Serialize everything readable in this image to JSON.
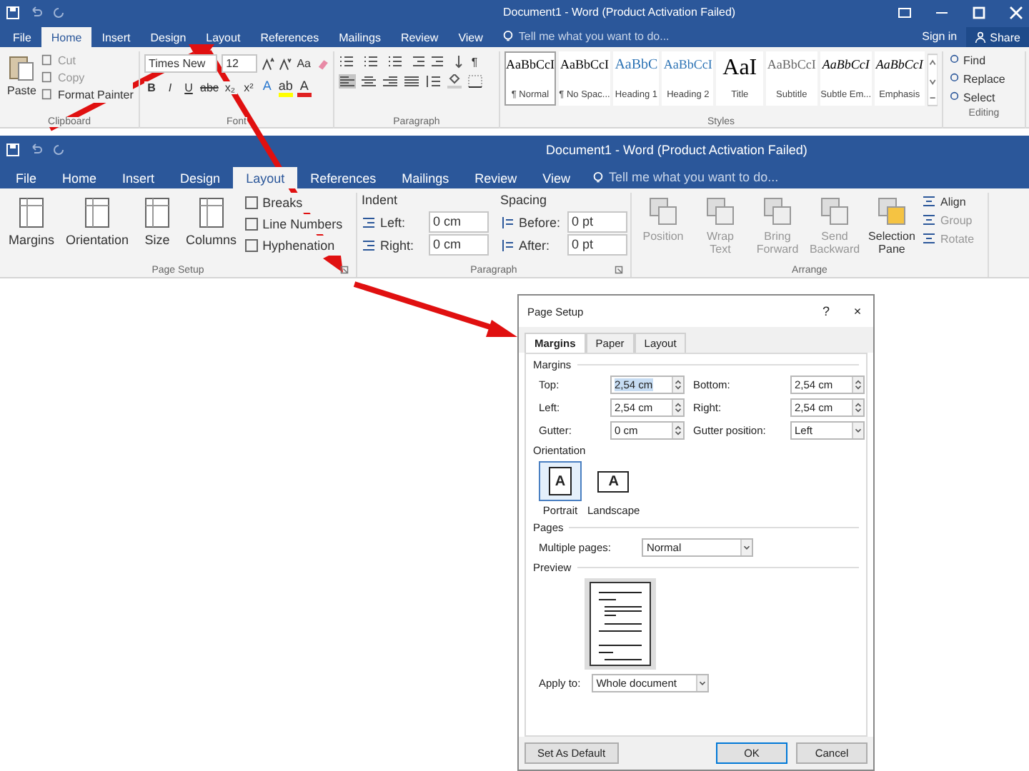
{
  "home_window": {
    "title": "Document1 - Word (Product Activation Failed)",
    "tabs": [
      {
        "label": "File",
        "selected": false
      },
      {
        "label": "Home",
        "selected": true
      },
      {
        "label": "Insert",
        "selected": false
      },
      {
        "label": "Design",
        "selected": false
      },
      {
        "label": "Layout",
        "selected": false
      },
      {
        "label": "References",
        "selected": false
      },
      {
        "label": "Mailings",
        "selected": false
      },
      {
        "label": "Review",
        "selected": false
      },
      {
        "label": "View",
        "selected": false
      }
    ],
    "tell_me": "Tell me what you want to do...",
    "sign_in": "Sign in",
    "share": "Share",
    "clipboard": {
      "paste": "Paste",
      "items": [
        {
          "label": "Cut",
          "disabled": true
        },
        {
          "label": "Copy",
          "disabled": true
        },
        {
          "label": "Format Painter",
          "disabled": false
        }
      ],
      "group": "Clipboard"
    },
    "font": {
      "name": "Times New",
      "size": "12",
      "case_button": "Aa",
      "format_buttons": [
        "B",
        "I",
        "U",
        "abc",
        "x₂",
        "x²"
      ],
      "color_buttons": [
        {
          "label": "A",
          "kind": "effects"
        },
        {
          "label": "ab",
          "kind": "highlight"
        },
        {
          "label": "A",
          "kind": "font-color"
        }
      ],
      "group": "Font"
    },
    "paragraph": {
      "pilcrow": "¶",
      "alignments": [
        {
          "kind": "left",
          "selected": true
        },
        {
          "kind": "center",
          "selected": false
        },
        {
          "kind": "right",
          "selected": false
        },
        {
          "kind": "justify",
          "selected": false
        }
      ],
      "group": "Paragraph"
    },
    "styles": {
      "items": [
        {
          "preview": "AaBbCcI",
          "name": "¶ Normal",
          "kind": "normal",
          "selected": true
        },
        {
          "preview": "AaBbCcI",
          "name": "¶ No Spac...",
          "kind": "normal",
          "selected": false
        },
        {
          "preview": "AaBbC",
          "name": "Heading 1",
          "kind": "heading1",
          "selected": false
        },
        {
          "preview": "AaBbCcI",
          "name": "Heading 2",
          "kind": "heading2",
          "selected": false
        },
        {
          "preview": "AaI",
          "name": "Title",
          "kind": "title",
          "selected": false
        },
        {
          "preview": "AaBbCcI",
          "name": "Subtitle",
          "kind": "subtitle",
          "selected": false
        },
        {
          "preview": "AaBbCcI",
          "name": "Subtle Em...",
          "kind": "emphasis",
          "selected": false
        },
        {
          "preview": "AaBbCcI",
          "name": "Emphasis",
          "kind": "emphasis",
          "selected": false
        }
      ],
      "group": "Styles"
    },
    "editing": {
      "items": [
        "Find",
        "Replace",
        "Select"
      ],
      "group": "Editing"
    }
  },
  "layout_window": {
    "title": "Document1 - Word (Product Activation Failed)",
    "tabs": [
      {
        "label": "File",
        "selected": false
      },
      {
        "label": "Home",
        "selected": false
      },
      {
        "label": "Insert",
        "selected": false
      },
      {
        "label": "Design",
        "selected": false
      },
      {
        "label": "Layout",
        "selected": true
      },
      {
        "label": "References",
        "selected": false
      },
      {
        "label": "Mailings",
        "selected": false
      },
      {
        "label": "Review",
        "selected": false
      },
      {
        "label": "View",
        "selected": false
      }
    ],
    "tell_me": "Tell me what you want to do...",
    "page_setup": {
      "big_buttons": [
        "Margins",
        "Orientation",
        "Size",
        "Columns"
      ],
      "small_buttons": [
        "Breaks",
        "Line Numbers",
        "Hyphenation"
      ],
      "group": "Page Setup"
    },
    "paragraph": {
      "indent_label": "Indent",
      "indent": [
        {
          "label": "Left:",
          "value": "0 cm"
        },
        {
          "label": "Right:",
          "value": "0 cm"
        }
      ],
      "spacing_label": "Spacing",
      "spacing": [
        {
          "label": "Before:",
          "value": "0 pt"
        },
        {
          "label": "After:",
          "value": "0 pt"
        }
      ],
      "group": "Paragraph"
    },
    "arrange": {
      "big_buttons": [
        {
          "label": "Position",
          "disabled": true
        },
        {
          "label": "Wrap Text",
          "disabled": true
        },
        {
          "label": "Bring Forward",
          "disabled": true
        },
        {
          "label": "Send Backward",
          "disabled": true
        },
        {
          "label": "Selection Pane",
          "disabled": false
        }
      ],
      "small_buttons": [
        {
          "label": "Align",
          "disabled": false
        },
        {
          "label": "Group",
          "disabled": true
        },
        {
          "label": "Rotate",
          "disabled": true
        }
      ],
      "group": "Arrange"
    }
  },
  "dialog": {
    "title": "Page Setup",
    "help": "?",
    "close": "×",
    "tabs": [
      {
        "label": "Margins",
        "selected": true
      },
      {
        "label": "Paper",
        "selected": false
      },
      {
        "label": "Layout",
        "selected": false
      }
    ],
    "margins_label": "Margins",
    "fields": [
      {
        "label": "Top:",
        "value": "2,54 cm",
        "selected": true
      },
      {
        "label": "Bottom:",
        "value": "2,54 cm",
        "selected": false
      },
      {
        "label": "Left:",
        "value": "2,54 cm",
        "selected": false
      },
      {
        "label": "Right:",
        "value": "2,54 cm",
        "selected": false
      },
      {
        "label": "Gutter:",
        "value": "0 cm",
        "selected": false
      }
    ],
    "gutter_position": {
      "label": "Gutter position:",
      "value": "Left"
    },
    "orientation_label": "Orientation",
    "orientations": [
      {
        "label": "Portrait",
        "glyph": "A",
        "selected": true
      },
      {
        "label": "Landscape",
        "glyph": "A",
        "selected": false
      }
    ],
    "pages_label": "Pages",
    "multiple_pages": {
      "label": "Multiple pages:",
      "value": "Normal"
    },
    "preview_label": "Preview",
    "apply_to": {
      "label": "Apply to:",
      "value": "Whole document"
    },
    "buttons": [
      {
        "label": "Set As Default",
        "kind": "secondary"
      },
      {
        "label": "OK",
        "kind": "default"
      },
      {
        "label": "Cancel",
        "kind": "secondary"
      }
    ]
  }
}
